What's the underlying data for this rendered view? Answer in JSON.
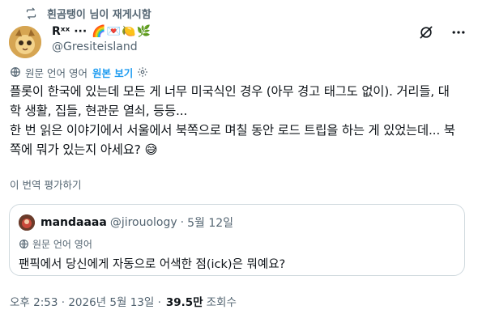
{
  "retweet": {
    "text": "흰곰탱이 님이 재게시함"
  },
  "author": {
    "name": "Rˣˣ ···",
    "emojis": "🌈💌🍋🌿",
    "handle": "@Gresiteisland"
  },
  "icons": {
    "retweet": "retweet-icon",
    "grok": "grok-icon",
    "more": "more-icon",
    "globe": "globe-icon",
    "settings": "gear-icon"
  },
  "translation": {
    "source_lang": "원문 언어 영어",
    "show_original": "원본 보기"
  },
  "tweet": {
    "lines": [
      "플롯이 한국에 있는데 모든 게 너무 미국식인 경우 (아무 경고 태그도 없이). 거리들, 대",
      "학 생활, 집들, 현관문 열쇠, 등등...",
      "한 번 읽은 이야기에서 서울에서 북쪽으로 며칠 동안 로드 트립을 하는 게 있었는데... 북",
      "쪽에 뭐가 있는지 아세요? 😅"
    ],
    "rate_translation": "이 번역 평가하기"
  },
  "quote": {
    "name": "mandaaaa",
    "handle": "@jirouology",
    "dot": "·",
    "date": "5월 12일",
    "source_lang": "원문 언어 영어",
    "text": "팬픽에서 당신에게 자동으로 어색한 점(ick)은 뭐예요?"
  },
  "meta": {
    "timestamp": "오후 2:53 · 2026년 5월 13일 ·",
    "views": "39.5만",
    "views_label": "조회수"
  },
  "colors": {
    "accent": "#1d9bf0",
    "secondary_text": "#536471",
    "border": "#cfd9de"
  }
}
